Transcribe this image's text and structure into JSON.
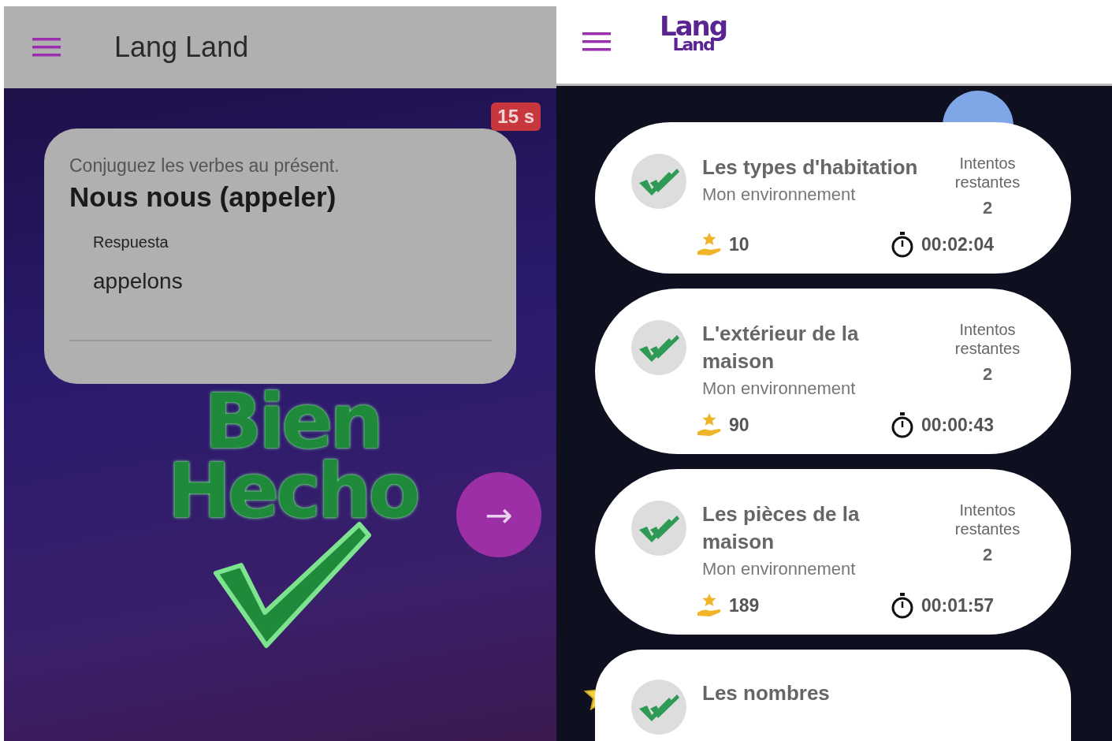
{
  "quiz_screen": {
    "app_bar": {
      "title": "Lang Land"
    },
    "timer": "15 s",
    "question_card": {
      "instruction": "Conjuguez les verbes au présent.",
      "prompt": "Nous nous (appeler)",
      "answer_field": {
        "label": "Respuesta",
        "value": "appelons"
      }
    },
    "feedback": "Bien Hecho",
    "next_button": {
      "icon": "→"
    }
  },
  "lessons_screen": {
    "app_bar": {
      "logo": [
        "Lang",
        "Land"
      ]
    },
    "lessons": [
      {
        "title": "Les types d'habitation",
        "subtitle": "Mon environnement",
        "attempts_label": "Intentos restantes",
        "attempts": "2",
        "score": "10",
        "time": "00:02:04"
      },
      {
        "title": "L'extérieur de la maison",
        "subtitle": "Mon environnement",
        "attempts_label": "Intentos restantes",
        "attempts": "2",
        "score": "90",
        "time": "00:00:43"
      },
      {
        "title": "Les pièces de la maison",
        "subtitle": "Mon environnement",
        "attempts_label": "Intentos restantes",
        "attempts": "2",
        "score": "189",
        "time": "00:01:57"
      },
      {
        "title": "Les nombres"
      }
    ]
  }
}
